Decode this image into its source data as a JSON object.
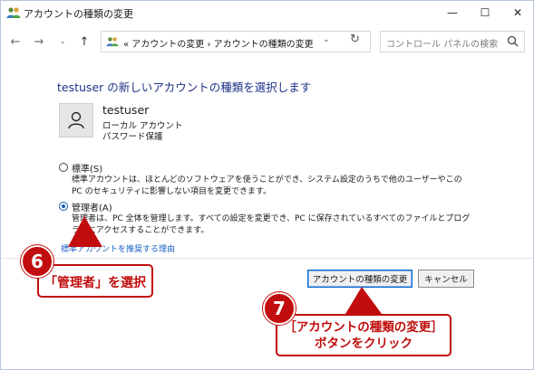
{
  "window": {
    "title": "アカウントの種類の変更",
    "minimize": "—",
    "maximize": "☐",
    "close": "✕"
  },
  "nav": {
    "back": "←",
    "forward": "→",
    "recent": "⌄",
    "up": "↑",
    "address": "« アカウントの変更 › アカウントの種類の変更",
    "address_dropdown": "⌄",
    "refresh": "↻",
    "search_placeholder": "コントロール パネルの検索",
    "search_icon": "search-icon"
  },
  "main": {
    "heading": "testuser の新しいアカウントの種類を選択します",
    "user": {
      "name": "testuser",
      "type": "ローカル アカウント",
      "password": "パスワード保護"
    },
    "options": [
      {
        "label": "標準(S)",
        "description": "標準アカウントは、ほとんどのソフトウェアを使うことができ、システム設定のうちで他のユーザーやこの PC のセキュリティに影響しない項目を変更できます。",
        "selected": false
      },
      {
        "label": "管理者(A)",
        "description": "管理者は、PC 全体を管理します。すべての設定を変更でき、PC に保存されているすべてのファイルとプログラムにアクセスすることができます。",
        "selected": true
      }
    ],
    "reason_link": "標準アカウントを推奨する理由",
    "change_button": "アカウントの種類の変更",
    "cancel_button": "キャンセル"
  },
  "annotations": {
    "step6_number": "6",
    "step6_text": "「管理者」を選択",
    "step7_number": "7",
    "step7_line1": "［アカウントの種類の変更］",
    "step7_line2": "ボタンをクリック",
    "accent_color": "#c10d0d"
  }
}
